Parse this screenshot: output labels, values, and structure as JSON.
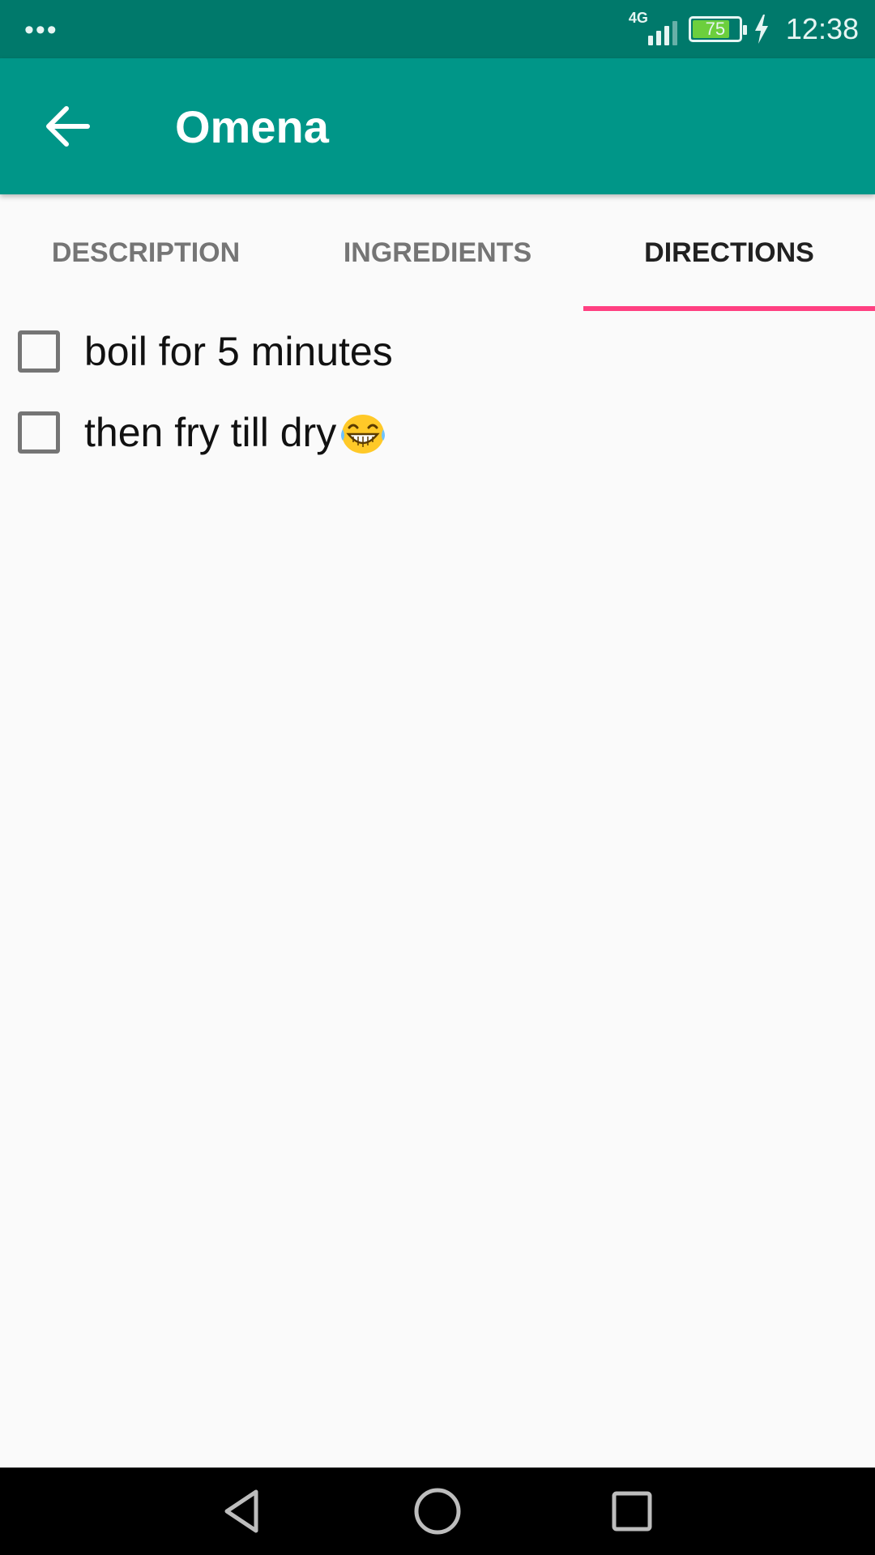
{
  "status_bar": {
    "network": "4G",
    "battery": "75",
    "time": "12:38"
  },
  "app_bar": {
    "title": "Omena"
  },
  "tabs": [
    {
      "label": "DESCRIPTION",
      "active": false
    },
    {
      "label": "INGREDIENTS",
      "active": false
    },
    {
      "label": "DIRECTIONS",
      "active": true
    }
  ],
  "directions": [
    {
      "text": "boil for 5 minutes",
      "checked": false
    },
    {
      "text": "then fry till dry",
      "checked": false,
      "emoji": "laughing-face-emoji"
    }
  ],
  "colors": {
    "status_bar": "#00796b",
    "app_bar": "#009688",
    "tab_indicator": "#ff4081",
    "battery_fill": "#6ccf3d"
  }
}
